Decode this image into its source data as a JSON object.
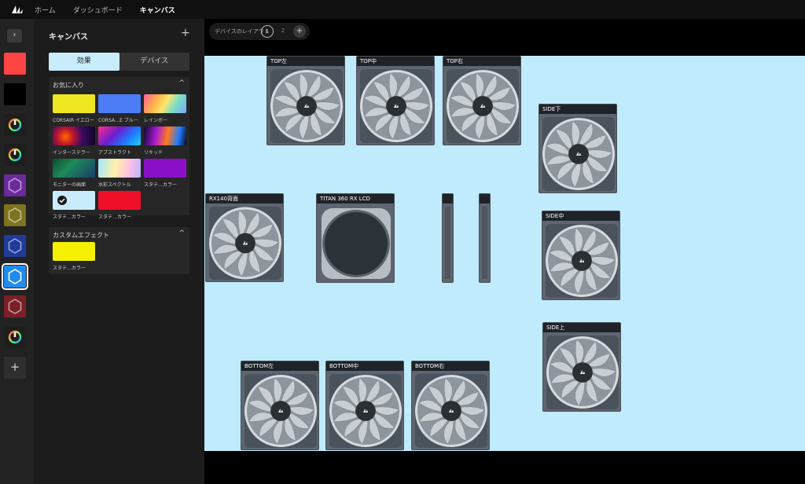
{
  "nav": {
    "logo_icon": "corsair-sails-icon",
    "items": [
      {
        "label": "ホーム",
        "active": false
      },
      {
        "label": "ダッシュボード",
        "active": false
      },
      {
        "label": "キャンバス",
        "active": true
      }
    ]
  },
  "rail": {
    "expand_icon": "chevron-right-icon",
    "expand_glyph": "›",
    "add_glyph": "+",
    "tiles": [
      {
        "name": "red-solid",
        "color": "#ff4444",
        "icon": "none"
      },
      {
        "name": "black-solid",
        "color": "#000000",
        "icon": "none"
      },
      {
        "name": "rainbow-power",
        "color": "#1e1e1e",
        "icon": "power-ring-icon"
      },
      {
        "name": "rainbow-power-2",
        "color": "#1e1e1e",
        "icon": "power-ring-icon"
      },
      {
        "name": "purple-hex",
        "color": "#6b2a9c",
        "icon": "hexagon-icon"
      },
      {
        "name": "olive-hex",
        "color": "#7e7420",
        "icon": "hexagon-icon"
      },
      {
        "name": "blue-hex",
        "color": "#1f3c9a",
        "icon": "hexagon-icon"
      },
      {
        "name": "lightblue-hex",
        "color": "#1f8bf0",
        "icon": "hexagon-icon",
        "selected": true
      },
      {
        "name": "darkred-hex",
        "color": "#7a1f28",
        "icon": "hexagon-icon"
      },
      {
        "name": "rainbow-power-3",
        "color": "#1e1e1e",
        "icon": "power-ring-icon"
      }
    ]
  },
  "panel": {
    "title": "キャンバス",
    "add_glyph": "+",
    "tabs": [
      {
        "label": "効果",
        "active": true
      },
      {
        "label": "デバイス",
        "active": false
      }
    ],
    "favorites": {
      "title": "お気に入り",
      "chevron": "^",
      "items": [
        {
          "label": "CORSAIR イエロー",
          "color": "#eee620"
        },
        {
          "label": "CORSA…E ブルー",
          "color": "#4c7cf6"
        },
        {
          "label": "レインボー",
          "color": "gradient-rainbow"
        },
        {
          "label": "インターステラー",
          "color": "gradient-interstellar"
        },
        {
          "label": "アブストラクト",
          "color": "gradient-abstract"
        },
        {
          "label": "リキッド",
          "color": "gradient-liquid"
        },
        {
          "label": "モニターの画面",
          "color": "gradient-monitor"
        },
        {
          "label": "水彩スペクトル",
          "color": "gradient-watercolor"
        },
        {
          "label": "スタテ…カラー",
          "color": "#8a10c8"
        },
        {
          "label": "スタテ…カラー",
          "color": "#c8ecfc",
          "checked": true
        },
        {
          "label": "スタテ…カラー",
          "color": "#f0102a"
        }
      ]
    },
    "custom": {
      "title": "カスタムエフェクト",
      "chevron": "^",
      "items": [
        {
          "label": "スタテ…カラー",
          "color": "#f5f000"
        }
      ]
    }
  },
  "toolbar": {
    "layout_label": "デバイスのレイアウト",
    "pages": [
      "1",
      "2"
    ],
    "active_page": "1",
    "add_glyph": "+"
  },
  "canvas": {
    "background": "#c0ebfc",
    "devices": [
      {
        "id": "top-left",
        "label": "TOP左",
        "type": "fan"
      },
      {
        "id": "top-mid",
        "label": "TOP中",
        "type": "fan"
      },
      {
        "id": "top-right",
        "label": "TOP右",
        "type": "fan"
      },
      {
        "id": "side-lower",
        "label": "SIDE下",
        "type": "fan"
      },
      {
        "id": "rx140-rear",
        "label": "RX140背面",
        "type": "fan"
      },
      {
        "id": "titan-lcd",
        "label": "TITAN 360 RX LCD",
        "type": "pump"
      },
      {
        "id": "strip-1",
        "label": "",
        "type": "strip"
      },
      {
        "id": "strip-2",
        "label": "",
        "type": "strip"
      },
      {
        "id": "side-mid",
        "label": "SIDE中",
        "type": "fan"
      },
      {
        "id": "side-upper",
        "label": "SIDE上",
        "type": "fan"
      },
      {
        "id": "bottom-left",
        "label": "BOTTOM左",
        "type": "fan"
      },
      {
        "id": "bottom-mid",
        "label": "BOTTOM中",
        "type": "fan"
      },
      {
        "id": "bottom-right",
        "label": "BOTTOM右",
        "type": "fan"
      }
    ]
  }
}
